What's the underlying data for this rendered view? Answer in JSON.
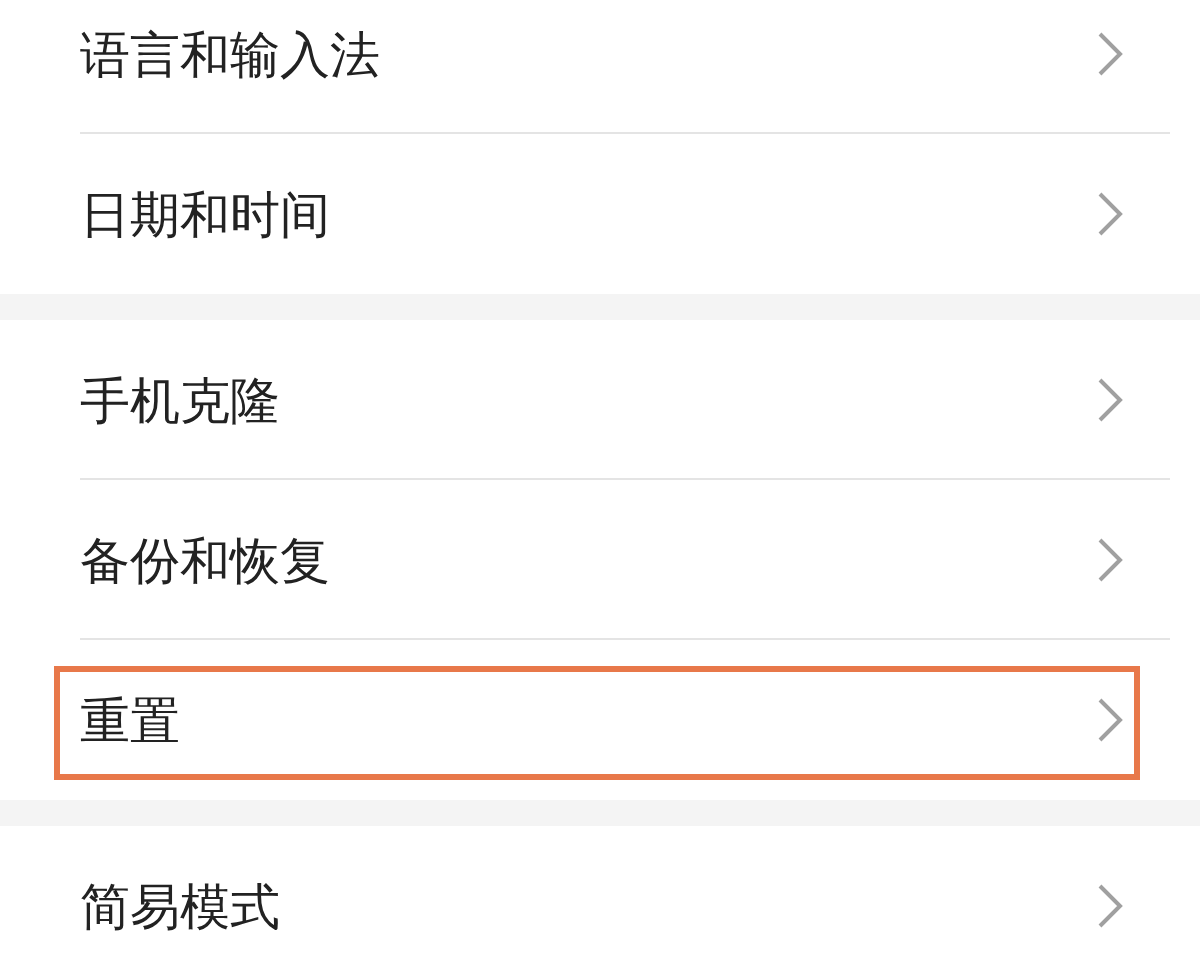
{
  "groups": [
    {
      "items": [
        {
          "label": "语言和输入法",
          "highlighted": false
        },
        {
          "label": "日期和时间",
          "highlighted": false
        }
      ]
    },
    {
      "items": [
        {
          "label": "手机克隆",
          "highlighted": false
        },
        {
          "label": "备份和恢复",
          "highlighted": false
        },
        {
          "label": "重置",
          "highlighted": true
        }
      ]
    },
    {
      "items": [
        {
          "label": "简易模式",
          "highlighted": false
        }
      ]
    }
  ]
}
